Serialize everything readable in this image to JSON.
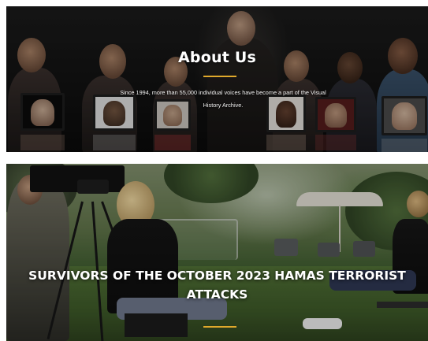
{
  "cards": [
    {
      "title": "About Us",
      "description": "Since 1994, more than 55,000 individual voices have become a part of the Visual History Archive."
    },
    {
      "title": "SURVIVORS OF THE OCTOBER 2023 HAMAS TERRORIST ATTACKS"
    }
  ],
  "colors": {
    "accent_rule": "#e0a92c",
    "title_text": "#ffffff"
  }
}
